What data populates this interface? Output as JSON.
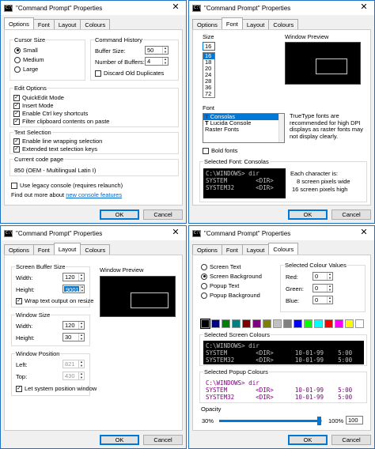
{
  "window_title": "\"Command Prompt\" Properties",
  "app_icon_text": "C:\\",
  "tabs": [
    "Options",
    "Font",
    "Layout",
    "Colours"
  ],
  "buttons": {
    "ok": "OK",
    "cancel": "Cancel"
  },
  "options": {
    "cursor_size": {
      "label": "Cursor Size",
      "small": "Small",
      "medium": "Medium",
      "large": "Large"
    },
    "history": {
      "label": "Command History",
      "buffer_size_label": "Buffer Size:",
      "buffer_size": "50",
      "num_buffers_label": "Number of Buffers:",
      "num_buffers": "4",
      "discard_label": "Discard Old Duplicates"
    },
    "edit": {
      "label": "Edit Options",
      "quickedit": "QuickEdit Mode",
      "insert": "Insert Mode",
      "ctrl_keys": "Enable Ctrl key shortcuts",
      "filter": "Filter clipboard contents on paste"
    },
    "text_sel": {
      "label": "Text Selection",
      "line_wrap": "Enable line wrapping selection",
      "extended": "Extended text selection keys"
    },
    "code_page": {
      "label": "Current code page",
      "value": "850   (OEM - Multilingual Latin I)"
    },
    "legacy": "Use legacy console (requires relaunch)",
    "find_out": "Find out more about",
    "find_link": "new console features"
  },
  "font": {
    "size_label": "Size",
    "size_input": "16",
    "sizes": [
      "16",
      "18",
      "20",
      "24",
      "28",
      "36",
      "72"
    ],
    "window_preview_label": "Window Preview",
    "font_label": "Font",
    "fonts": [
      "Consolas",
      "Lucida Console",
      "Raster Fonts"
    ],
    "font_icon": "T",
    "tt_note": "TrueType fonts are recommended for high DPI displays as raster fonts may not display clearly.",
    "bold_label": "Bold fonts",
    "selected_font_label": "Selected Font: Consolas",
    "preview_lines": [
      "C:\\WINDOWS> dir",
      "SYSTEM        <DIR>",
      "SYSTEM32      <DIR>"
    ],
    "char_label": "Each character is:",
    "char_w": "8 screen pixels wide",
    "char_h": "16 screen pixels high"
  },
  "layout": {
    "buffer": {
      "label": "Screen Buffer Size",
      "width_label": "Width:",
      "width": "120",
      "height_label": "Height:",
      "height": "9001",
      "wrap_label": "Wrap text output on resize"
    },
    "window_preview_label": "Window Preview",
    "wsize": {
      "label": "Window Size",
      "width_label": "Width:",
      "width": "120",
      "height_label": "Height:",
      "height": "30"
    },
    "wpos": {
      "label": "Window Position",
      "left_label": "Left:",
      "left": "821",
      "top_label": "Top:",
      "top": "430",
      "let_system": "Let system position window"
    }
  },
  "colours": {
    "targets": [
      "Screen Text",
      "Screen Background",
      "Popup Text",
      "Popup Background"
    ],
    "selected_values_label": "Selected Colour Values",
    "red_label": "Red:",
    "red": "0",
    "green_label": "Green:",
    "green": "0",
    "blue_label": "Blue:",
    "blue": "0",
    "palette": [
      "#000000",
      "#000080",
      "#008000",
      "#008080",
      "#800000",
      "#800080",
      "#808000",
      "#c0c0c0",
      "#808080",
      "#0000ff",
      "#00ff00",
      "#00ffff",
      "#ff0000",
      "#ff00ff",
      "#ffff00",
      "#ffffff"
    ],
    "screen_label": "Selected Screen Colours",
    "screen_lines": [
      "C:\\WINDOWS> dir",
      "SYSTEM        <DIR>      10-01-99    5:00",
      "SYSTEM32      <DIR>      10-01-99    5:00"
    ],
    "popup_label": "Selected Popup Colours",
    "popup_lines": [
      "C:\\WINDOWS> dir",
      "SYSTEM        <DIR>      10-01-99    5:00",
      "SYSTEM32      <DIR>      10-01-99    5:00"
    ],
    "opacity_label": "Opacity",
    "opacity_min": "30%",
    "opacity_max": "100%",
    "opacity_value": "100",
    "screen_text_color": "#c0c0c0",
    "popup_text_color": "#800080"
  }
}
